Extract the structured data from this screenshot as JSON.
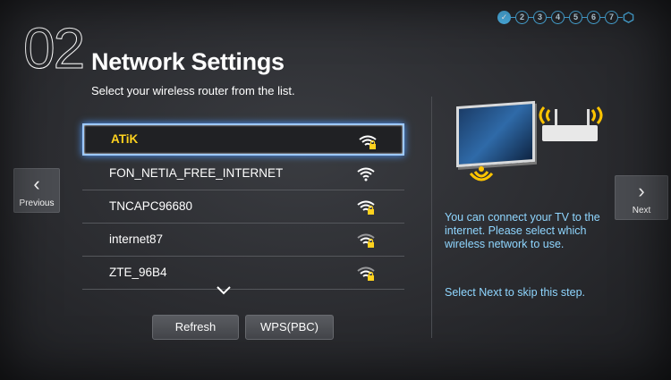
{
  "steps": {
    "labels": [
      "2",
      "3",
      "4",
      "5",
      "6",
      "7"
    ]
  },
  "header": {
    "step_number": "02",
    "title": "Network Settings",
    "subtitle": "Select your wireless router from the list."
  },
  "nav": {
    "previous_label": "Previous",
    "next_label": "Next"
  },
  "networks": [
    {
      "name": "ATiK"
    },
    {
      "name": "FON_NETIA_FREE_INTERNET"
    },
    {
      "name": "TNCAPC96680"
    },
    {
      "name": "internet87"
    },
    {
      "name": "ZTE_96B4"
    }
  ],
  "buttons": {
    "refresh": "Refresh",
    "wps": "WPS(PBC)"
  },
  "info": {
    "description": "You can connect your TV to the internet. Please select which wireless network to use.",
    "skip_hint": "Select Next to skip this step."
  },
  "colors": {
    "accent": "#4fb8ee",
    "selected_text": "#ffd21e",
    "info_text": "#8fd6ff"
  }
}
